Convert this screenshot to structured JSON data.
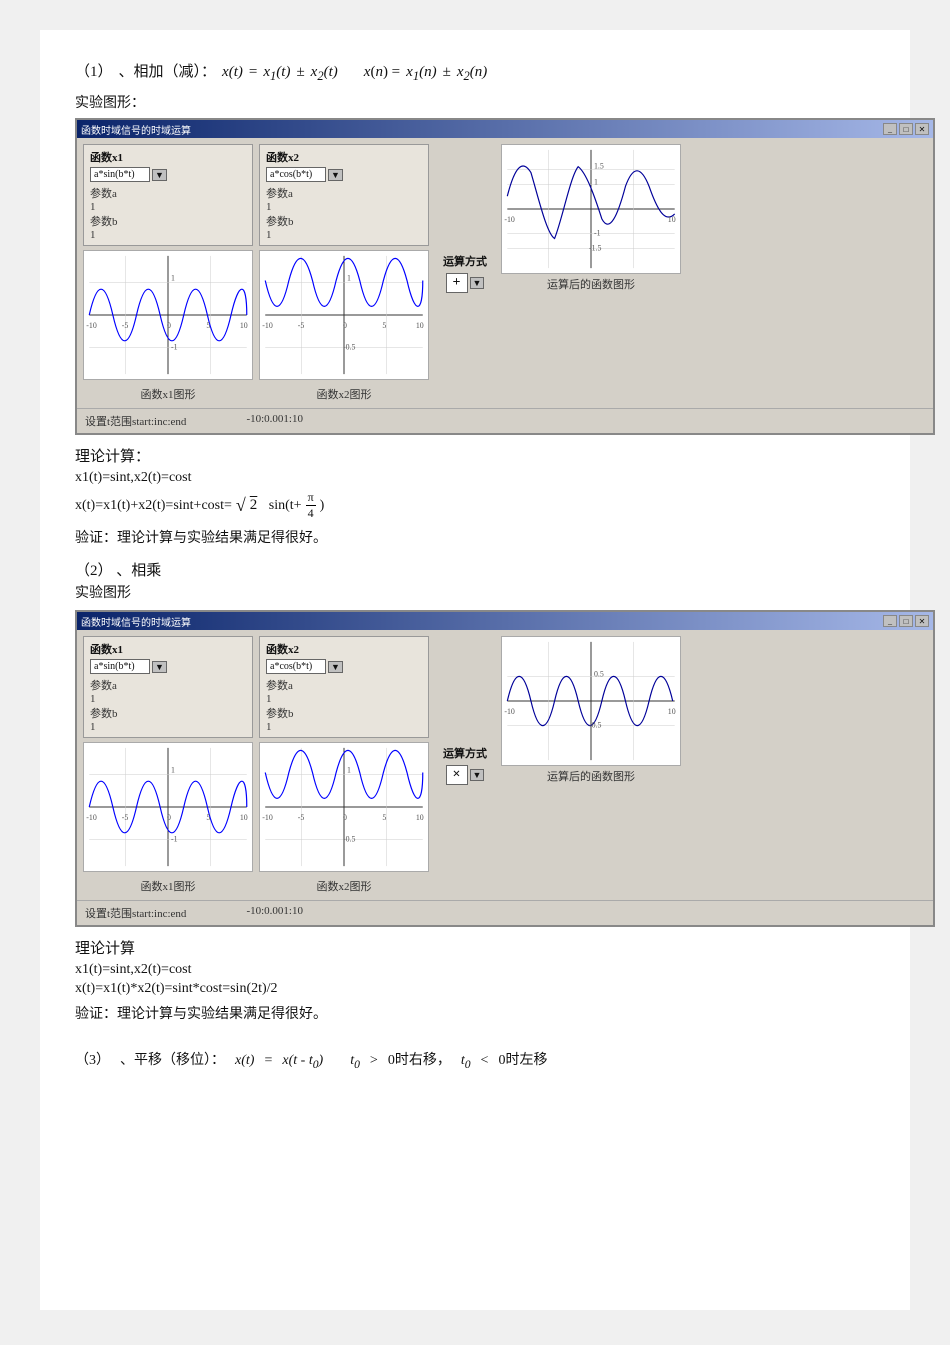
{
  "page": {
    "background": "#f0f0f0"
  },
  "section1": {
    "number": "（1）",
    "operation": "、相加（减）：",
    "formulas": [
      "x t",
      "x₁ t",
      "x₂ t",
      "x n",
      "x₁ n",
      "x₂ n"
    ],
    "experiment_title": "实验图形："
  },
  "window1": {
    "title": "函数时域信号的时域运算",
    "func1_label": "函数x1",
    "func1_dropdown": "a*sin(b*t)",
    "func1_param_a_label": "参数a",
    "func1_param_a_val": "1",
    "func1_param_b_label": "参数b",
    "func1_param_b_val": "1",
    "func1_graph_label": "函数x1图形",
    "func2_label": "函数x2",
    "func2_dropdown": "a*cos(b*t)",
    "func2_param_a_label": "参数a",
    "func2_param_a_val": "1",
    "func2_param_b_label": "参数b",
    "func2_param_b_val": "1",
    "func2_graph_label": "函数x2图形",
    "op_label": "运算方式",
    "op_symbol": "+",
    "result_label": "运算后的函数图形",
    "footer_range": "设置t范围start:inc:end",
    "footer_value": "-10:0.001:10"
  },
  "theory1": {
    "title": "理论计算：",
    "line1": "x1(t)=sint,x2(t)=cost",
    "line2_prefix": "x(t)=x1(t)+x2(t)=sint+cost=",
    "line2_sqrt": "√2",
    "line2_suffix": "sin(t+",
    "line2_fraction": "π/4",
    "line2_end": "/4)",
    "verify": "验证：理论计算与实验结果满足得很好。"
  },
  "section2": {
    "number": "（2）",
    "operation": "、相乘",
    "experiment_title": "实验图形"
  },
  "window2": {
    "title": "函数时域信号的时域运算",
    "func1_label": "函数x1",
    "func1_dropdown": "a*sin(b*t)",
    "func1_param_a_label": "参数a",
    "func1_param_a_val": "1",
    "func1_param_b_label": "参数b",
    "func1_param_b_val": "1",
    "func1_graph_label": "函数x1图形",
    "func2_label": "函数x2",
    "func2_dropdown": "a*cos(b*t)",
    "func2_param_a_label": "参数a",
    "func2_param_a_val": "1",
    "func2_param_b_label": "参数b",
    "func2_param_b_val": "1",
    "func2_graph_label": "函数x2图形",
    "op_label": "运算方式",
    "op_symbol": "×",
    "result_label": "运算后的函数图形",
    "footer_range": "设置t范围start:inc:end",
    "footer_value": "-10:0.001:10"
  },
  "theory2": {
    "title": "理论计算",
    "line1": "x1(t)=sint,x2(t)=cost",
    "line2": "x(t)=x1(t)*x2(t)=sint*cost=sin(2t)/2",
    "verify": "验证：理论计算与实验结果满足得很好。"
  },
  "section3": {
    "number": "（3）",
    "operation": "、平移（移位）：",
    "formulas": [
      "x t",
      "x t  t₀",
      "t₀",
      "0时右移，",
      "t₀",
      "0时左移"
    ]
  }
}
